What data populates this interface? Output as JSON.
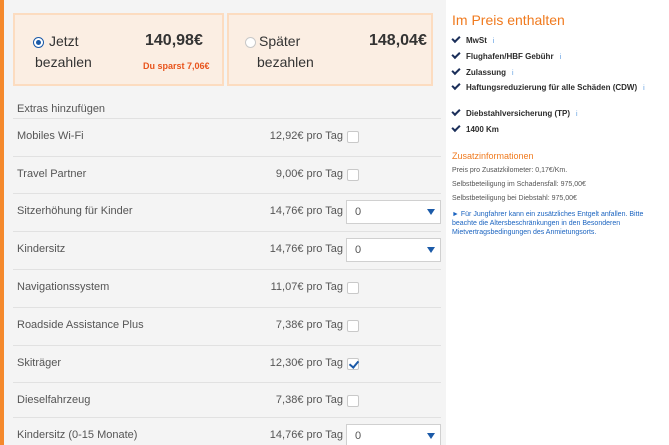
{
  "colors": {
    "accent": "#f5892c",
    "blue": "#1b5aa8",
    "orange_text": "#f07a1e",
    "save_red": "#e8541c"
  },
  "payment": {
    "now": {
      "label_line1": "Jetzt",
      "label_line2": "bezahlen",
      "price": "140,98€",
      "save": "Du sparst 7,06€",
      "selected": true
    },
    "later": {
      "label_line1": "Später",
      "label_line2": "bezahlen",
      "price": "148,04€",
      "selected": false
    }
  },
  "extras": {
    "title": "Extras hinzufügen",
    "items": [
      {
        "label": "Mobiles Wi-Fi",
        "price": "12,92€ pro Tag",
        "control": "checkbox",
        "checked": false
      },
      {
        "label": "Travel Partner",
        "price": "9,00€ pro Tag",
        "control": "checkbox",
        "checked": false
      },
      {
        "label": "Sitzerhöhung für Kinder",
        "price": "14,76€ pro Tag",
        "control": "select",
        "value": "0"
      },
      {
        "label": "Kindersitz",
        "price": "14,76€ pro Tag",
        "control": "select",
        "value": "0"
      },
      {
        "label": "Navigationssystem",
        "price": "11,07€ pro Tag",
        "control": "checkbox",
        "checked": false
      },
      {
        "label": "Roadside Assistance Plus",
        "price": "7,38€ pro Tag",
        "control": "checkbox",
        "checked": false
      },
      {
        "label": "Skiträger",
        "price": "12,30€ pro Tag",
        "control": "checkbox",
        "checked": true
      },
      {
        "label": "Dieselfahrzeug",
        "price": "7,38€ pro Tag",
        "control": "checkbox",
        "checked": false
      },
      {
        "label": "Kindersitz (0-15 Monate)",
        "price": "14,76€ pro Tag",
        "control": "select",
        "value": "0"
      }
    ]
  },
  "sidebar": {
    "title": "Im Preis enthalten",
    "included": [
      {
        "label": "MwSt",
        "info": "i"
      },
      {
        "label": "Flughafen/HBF Gebühr",
        "info": "i"
      },
      {
        "label": "Zulassung",
        "info": "i"
      },
      {
        "label": "Haftungsreduzierung für alle Schäden (CDW)",
        "info": "i"
      },
      {
        "label": "Diebstahlversicherung (TP)",
        "info": "i"
      },
      {
        "label": "1400 Km",
        "info": ""
      }
    ],
    "zusatz_title": "Zusatzinformationen",
    "zusatz_lines": [
      "Preis pro Zusatzkilometer: 0,17€/Km.",
      "Selbstbeteiligung im Schadensfall: 975,00€",
      "Selbstbeteiligung bei Diebstahl: 975,00€"
    ],
    "note": "► Für Jungfahrer kann ein zusätzliches Entgelt anfallen. Bitte beachte die Altersbeschränkungen in den Besonderen Mietvertragsbedingungen des Anmietungsorts."
  }
}
